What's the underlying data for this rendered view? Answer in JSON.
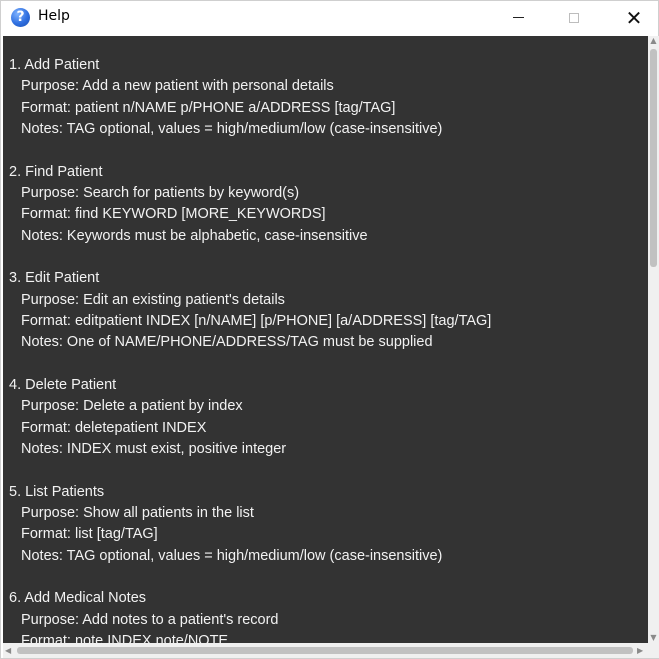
{
  "window": {
    "title": "Help",
    "icon": "help-question-icon"
  },
  "controls": {
    "minimize_icon": "minimize-icon",
    "maximize_icon": "maximize-icon",
    "close_glyph": "✕"
  },
  "sections": [
    {
      "heading": "1. Add Patient",
      "purpose": "Purpose: Add a new patient with personal details",
      "format": "Format: patient n/NAME p/PHONE a/ADDRESS [tag/TAG]",
      "notes": "Notes: TAG optional, values = high/medium/low (case-insensitive)"
    },
    {
      "heading": "2. Find Patient",
      "purpose": "Purpose: Search for patients by keyword(s)",
      "format": "Format: find KEYWORD [MORE_KEYWORDS]",
      "notes": "Notes: Keywords must be alphabetic, case-insensitive"
    },
    {
      "heading": "3. Edit Patient",
      "purpose": "Purpose: Edit an existing patient's details",
      "format": "Format: editpatient INDEX [n/NAME] [p/PHONE] [a/ADDRESS] [tag/TAG]",
      "notes": "Notes: One of NAME/PHONE/ADDRESS/TAG must be supplied"
    },
    {
      "heading": "4. Delete Patient",
      "purpose": "Purpose: Delete a patient by index",
      "format": "Format: deletepatient INDEX",
      "notes": "Notes: INDEX must exist, positive integer"
    },
    {
      "heading": "5. List Patients",
      "purpose": "Purpose: Show all patients in the list",
      "format": "Format: list [tag/TAG]",
      "notes": "Notes: TAG optional, values = high/medium/low (case-insensitive)"
    },
    {
      "heading": "6. Add Medical Notes",
      "purpose": "Purpose: Add notes to a patient's record",
      "format": "Format: note INDEX note/NOTE",
      "notes": ""
    }
  ],
  "colors": {
    "content_background": "#333333",
    "text": "#f2f2f2",
    "titlebar": "#ffffff"
  }
}
